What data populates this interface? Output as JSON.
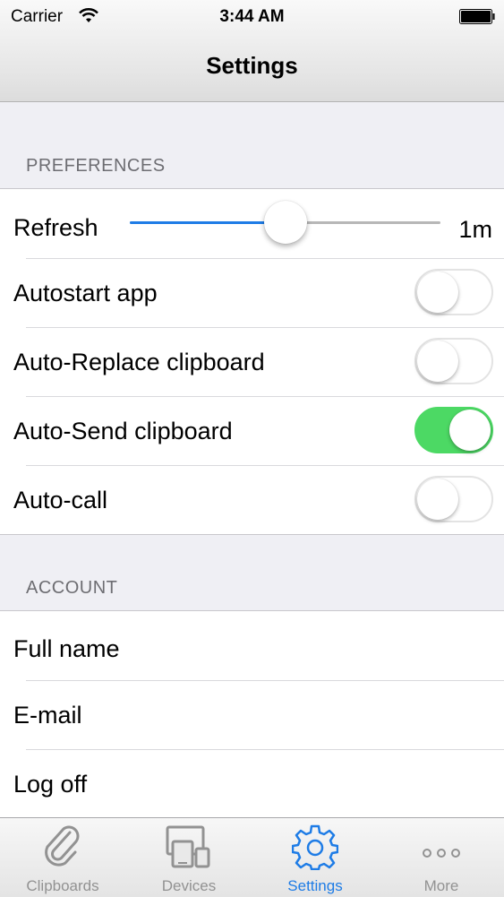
{
  "status_bar": {
    "carrier": "Carrier",
    "time": "3:44 AM"
  },
  "nav": {
    "title": "Settings"
  },
  "preferences": {
    "header": "PREFERENCES",
    "refresh": {
      "label": "Refresh",
      "value_text": "1m",
      "slider_fraction": 0.5
    },
    "toggles": [
      {
        "label": "Autostart app",
        "on": false
      },
      {
        "label": "Auto-Replace clipboard",
        "on": false
      },
      {
        "label": "Auto-Send clipboard",
        "on": true
      },
      {
        "label": "Auto-call",
        "on": false
      }
    ]
  },
  "account": {
    "header": "ACCOUNT",
    "items": [
      "Full name",
      "E-mail",
      "Log off"
    ]
  },
  "tabbar": {
    "tabs": [
      {
        "label": "Clipboards",
        "icon": "paperclip-icon",
        "active": false
      },
      {
        "label": "Devices",
        "icon": "devices-icon",
        "active": false
      },
      {
        "label": "Settings",
        "icon": "gear-icon",
        "active": true
      },
      {
        "label": "More",
        "icon": "more-icon",
        "active": false
      }
    ]
  },
  "colors": {
    "accent": "#1e7ce6",
    "switch_on": "#4cd964",
    "inactive_tab": "#929292"
  }
}
